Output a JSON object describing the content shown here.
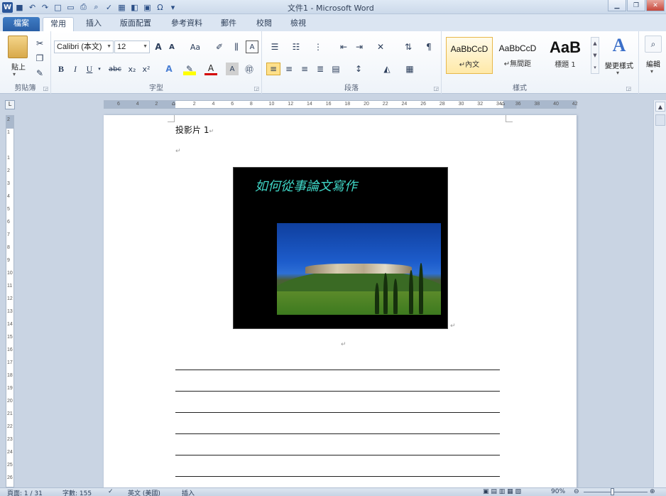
{
  "titlebar": {
    "title": "文件1 - Microsoft Word",
    "qat_icons": [
      "word-icon",
      "save-icon",
      "undo-icon",
      "redo-icon",
      "new-icon",
      "open-icon",
      "print-icon",
      "print-preview-icon",
      "spelling-icon",
      "table-icon",
      "insert-icon",
      "symbol-icon",
      "customize-icon"
    ]
  },
  "tabs": [
    {
      "label": "檔案"
    },
    {
      "label": "常用"
    },
    {
      "label": "插入"
    },
    {
      "label": "版面配置"
    },
    {
      "label": "參考資料"
    },
    {
      "label": "郵件"
    },
    {
      "label": "校閱"
    },
    {
      "label": "檢視"
    }
  ],
  "ribbon": {
    "clipboard": {
      "paste_label": "貼上",
      "group_label": "剪貼簿"
    },
    "font": {
      "font_name": "Calibri (本文)",
      "font_size": "12",
      "group_label": "字型",
      "bold": "B",
      "italic": "I",
      "underline": "U",
      "strike": "abc",
      "subscript": "x₂",
      "superscript": "x²",
      "grow": "A",
      "shrink": "A",
      "case": "Aa",
      "clear": "A",
      "color_a": "A"
    },
    "paragraph": {
      "group_label": "段落"
    },
    "styles": {
      "group_label": "樣式",
      "items": [
        {
          "preview": "AaBbCcD",
          "name": "↵內文"
        },
        {
          "preview": "AaBbCcD",
          "name": "↵無間距"
        },
        {
          "preview": "AaB",
          "name": "標題 1"
        }
      ],
      "change_label": "變更樣式"
    },
    "editing": {
      "label": "編輯"
    }
  },
  "ruler": {
    "h_ticks": [
      "6",
      "4",
      "2",
      "",
      "2",
      "4",
      "6",
      "8",
      "10",
      "12",
      "14",
      "16",
      "18",
      "20",
      "22",
      "24",
      "26",
      "28",
      "30",
      "32",
      "34",
      "36",
      "38",
      "40",
      "42"
    ],
    "v_ticks": [
      "2",
      "1",
      "",
      "1",
      "2",
      "3",
      "4",
      "5",
      "6",
      "7",
      "8",
      "9",
      "10",
      "11",
      "12",
      "13",
      "14",
      "15",
      "16",
      "17",
      "18",
      "19",
      "20",
      "21",
      "22",
      "23",
      "24",
      "25",
      "26"
    ]
  },
  "document": {
    "heading": "投影片 1",
    "slide_title": "如何從事論文寫作"
  },
  "statusbar": {
    "page": "頁面: 1 / 31",
    "words": "字數: 155",
    "language": "英文 (美國)",
    "mode": "插入",
    "zoom": "90%"
  }
}
